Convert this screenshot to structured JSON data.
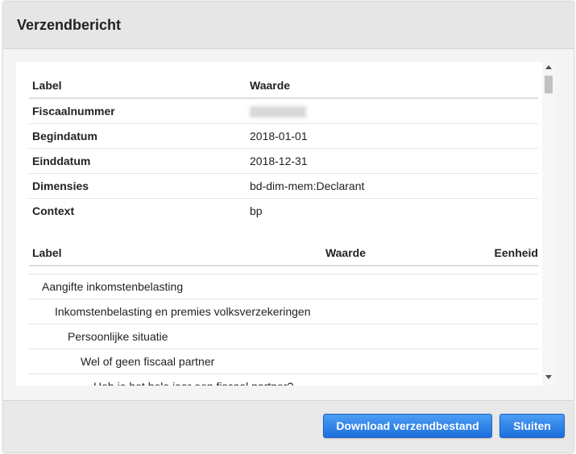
{
  "dialog": {
    "title": "Verzendbericht"
  },
  "context_table": {
    "headers": {
      "label": "Label",
      "value": "Waarde"
    },
    "rows": [
      {
        "label": "Fiscaalnummer",
        "value": ""
      },
      {
        "label": "Begindatum",
        "value": "2018-01-01"
      },
      {
        "label": "Einddatum",
        "value": "2018-12-31"
      },
      {
        "label": "Dimensies",
        "value": "bd-dim-mem:Declarant"
      },
      {
        "label": "Context",
        "value": "bp"
      }
    ]
  },
  "facts_table": {
    "headers": {
      "label": "Label",
      "value": "Waarde",
      "unit": "Eenheid"
    },
    "rows": [
      {
        "label": "Aangifte inkomstenbelasting",
        "level": 0
      },
      {
        "label": "Inkomstenbelasting en premies volksverzekeringen",
        "level": 1
      },
      {
        "label": "Persoonlijke situatie",
        "level": 2
      },
      {
        "label": "Wel of geen fiscaal partner",
        "level": 3
      },
      {
        "label": "Heb je het hele jaar een fiscaal partner?",
        "level": 4
      }
    ]
  },
  "footer": {
    "download_label": "Download verzendbestand",
    "close_label": "Sluiten"
  },
  "colors": {
    "button_primary": "#1b6fdc",
    "header_background": "#e6e6e6"
  }
}
